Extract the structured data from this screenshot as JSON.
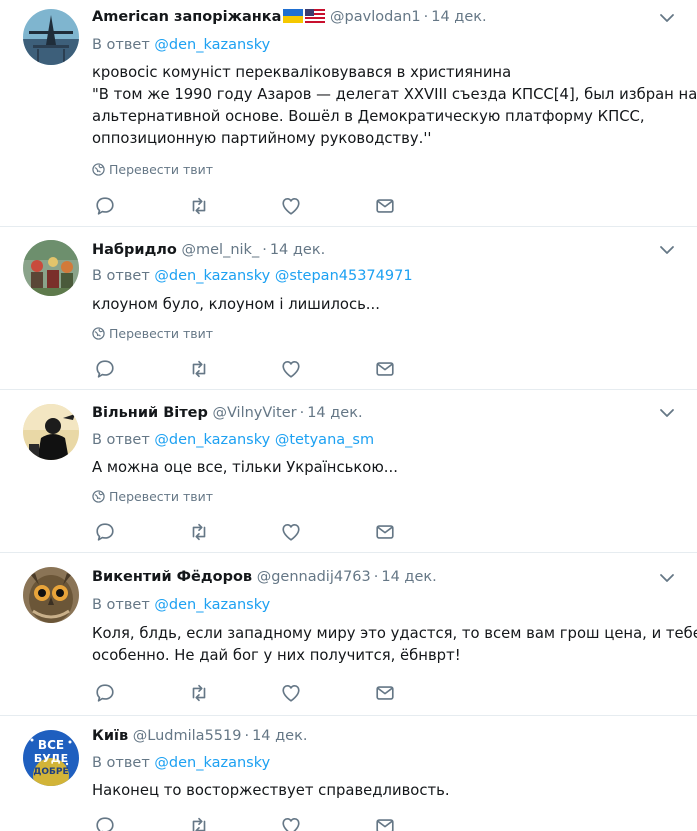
{
  "reply_prefix": "В ответ",
  "translate_label": "Перевести твит",
  "sep": "·",
  "colors": {
    "link": "#1da1f2",
    "muted": "#657786",
    "text": "#14171a",
    "divider": "#e6ecf0"
  },
  "icons": [
    "reply-icon",
    "retweet-icon",
    "like-icon",
    "direct-message-icon",
    "chevron-down-icon",
    "globe-icon"
  ],
  "tweets": [
    {
      "name": "American запоріжанка",
      "flags": "ukraine-usa-flags",
      "handle": "@pavlodan1",
      "time": "14 дек.",
      "mentions": [
        "@den_kazansky"
      ],
      "text_lines": [
        "кровосіс комуніст перекваліковувався в християнина",
        "\"В том же 1990 году Азаров — делегат XXVIII съезда КПСС[4], был избран на",
        "альтернативной основе. Вошёл в Демократическую платформу КПСС,",
        "оппозиционную партийному руководству.''"
      ]
    },
    {
      "name": "Набридло",
      "handle": "@mel_nik_",
      "time": "14 дек.",
      "mentions": [
        "@den_kazansky",
        "@stepan45374971"
      ],
      "text_lines": [
        "клоуном було, клоуном і лишилось..."
      ]
    },
    {
      "name": "Вільний Вітер",
      "handle": "@VilnyViter",
      "time": "14 дек.",
      "mentions": [
        "@den_kazansky",
        "@tetyana_sm"
      ],
      "text_lines": [
        "А можна оце все, тільки Українською..."
      ]
    },
    {
      "name": "Викентий Фёдоров",
      "handle": "@gennadij4763",
      "time": "14 дек.",
      "mentions": [
        "@den_kazansky"
      ],
      "text_lines": [
        "Коля, блдь, если западному миру это удастся, то всем вам грош цена, и тебе -",
        "особенно. Не дай бог у них получится, ёбнврт!"
      ]
    },
    {
      "name": "Київ",
      "handle": "@Ludmila5519",
      "time": "14 дек.",
      "mentions": [
        "@den_kazansky"
      ],
      "avatar_text": [
        "ВСЕ",
        "БУДЕ",
        "ДОБРЕ"
      ],
      "text_lines": [
        "Наконец то восторжествует справедливость."
      ]
    }
  ]
}
